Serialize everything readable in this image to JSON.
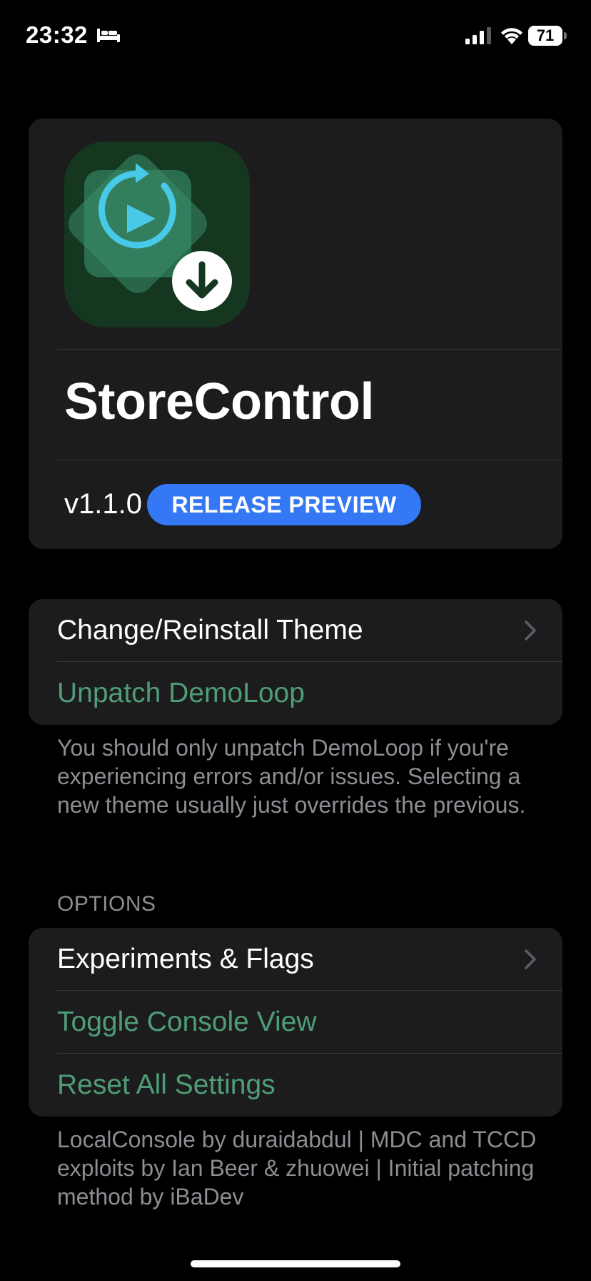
{
  "status_bar": {
    "time": "23:32",
    "battery": "71",
    "icons": [
      "bed-icon",
      "signal-icon",
      "wifi-icon",
      "battery-icon"
    ]
  },
  "app": {
    "name": "StoreControl",
    "version": "v1.1.0",
    "badge": "RELEASE PREVIEW",
    "icon": "app-icon-refresh-play-download",
    "badge_color": "#3478f6"
  },
  "theme_section": {
    "rows": [
      {
        "label": "Change/Reinstall Theme",
        "style": "white",
        "chevron": true
      },
      {
        "label": "Unpatch DemoLoop",
        "style": "green",
        "chevron": false
      }
    ],
    "footer": "You should only unpatch DemoLoop if you're experiencing errors and/or issues. Selecting a new theme usually just overrides the previous."
  },
  "options_section": {
    "header": "OPTIONS",
    "rows": [
      {
        "label": "Experiments & Flags",
        "style": "white",
        "chevron": true
      },
      {
        "label": "Toggle Console View",
        "style": "green",
        "chevron": false
      },
      {
        "label": "Reset All Settings",
        "style": "green",
        "chevron": false
      }
    ],
    "footer": "LocalConsole by duraidabdul | MDC and TCCD exploits by Ian Beer & zhuowei | Initial patching method by iBaDev"
  },
  "colors": {
    "background": "#000000",
    "card": "#1c1c1e",
    "accent_green": "#4f9d75",
    "secondary_text": "#8d8d93"
  }
}
